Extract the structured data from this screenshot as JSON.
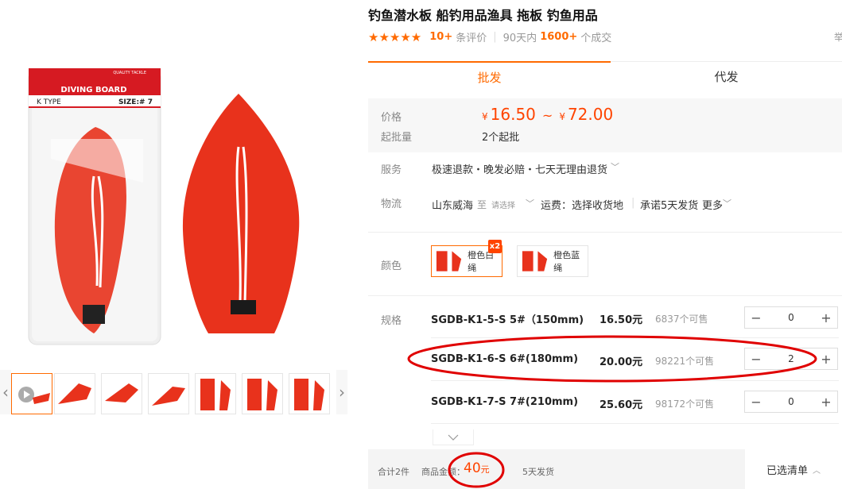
{
  "product": {
    "title": "钓鱼潜水板 船钓用品渔具 拖板 钓鱼用品",
    "stars": "★★★★★",
    "review_count": "10+",
    "review_label": "条评价",
    "sales_period": "90天内",
    "sales_count": "1600+",
    "sales_label": "个成交",
    "meta_right": "举"
  },
  "package": {
    "header_small": "QUALITY TACKLE",
    "brand": "DIVING BOARD",
    "type": "K TYPE",
    "size": "SIZE:# 7"
  },
  "gallery": {
    "thumb_count": 7,
    "active_index": 0
  },
  "tabs": {
    "wholesale": "批发",
    "dropship": "代发"
  },
  "pricing": {
    "price_label": "价格",
    "currency": "¥",
    "price_min": "16.50",
    "price_sep": "~",
    "price_max": "72.00",
    "moq_label": "起批量",
    "moq_value": "2个起批"
  },
  "service": {
    "label": "服务",
    "value": "极速退款・晚发必赔・七天无理由退货"
  },
  "logistics": {
    "label": "物流",
    "origin": "山东威海",
    "to": "至",
    "select": "请选择",
    "fee": "运费：选择收货地",
    "promise": "承诺5天发货",
    "more": "更多"
  },
  "colors": {
    "label": "颜色",
    "badge": "x2",
    "options": [
      {
        "name": "橙色白绳"
      },
      {
        "name": "橙色蓝绳"
      }
    ]
  },
  "specs": {
    "label": "规格",
    "rows": [
      {
        "name": "SGDB-K1-5-S 5#（150mm)",
        "price": "16.50元",
        "stock": "6837个可售",
        "qty": "0"
      },
      {
        "name": "SGDB-K1-6-S 6#(180mm)",
        "price": "20.00元",
        "stock": "98221个可售",
        "qty": "2"
      },
      {
        "name": "SGDB-K1-7-S 7#(210mm)",
        "price": "25.60元",
        "stock": "98172个可售",
        "qty": "0"
      }
    ]
  },
  "footer": {
    "total": "合计2件",
    "amount_label": "商品金额：",
    "amount": "40",
    "amount_unit": "元",
    "ship": "5天发货",
    "selected_list": "已选清单"
  },
  "theme": {
    "accent": "#ff6a00",
    "price": "#ff4400",
    "annotation": "#e00000",
    "board": "#e8321c"
  }
}
